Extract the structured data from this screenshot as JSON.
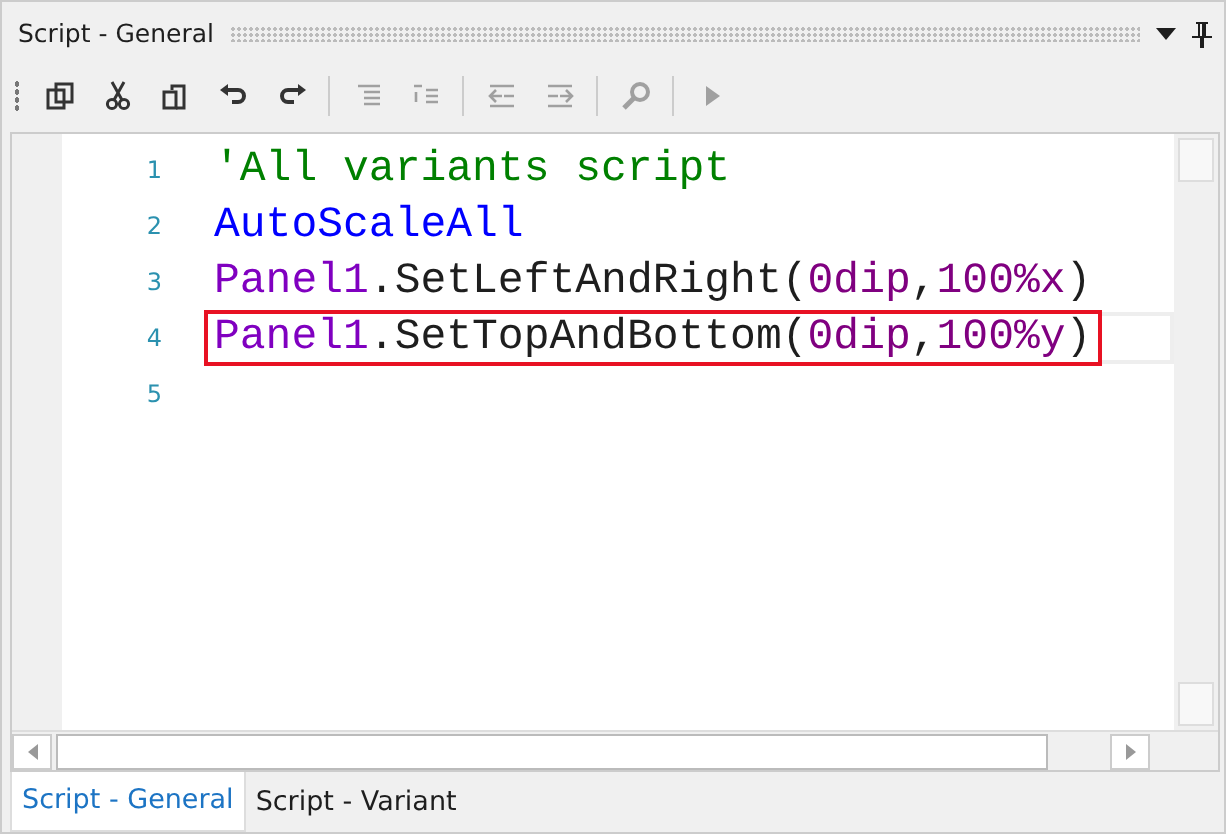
{
  "panel": {
    "title": "Script - General"
  },
  "toolbar": [
    {
      "kind": "copy",
      "disabled": false
    },
    {
      "kind": "cut",
      "disabled": false
    },
    {
      "kind": "paste",
      "disabled": false
    },
    {
      "kind": "undo",
      "disabled": false
    },
    {
      "kind": "redo",
      "disabled": false
    },
    {
      "kind": "sep"
    },
    {
      "kind": "comment",
      "disabled": true
    },
    {
      "kind": "uncomment",
      "disabled": true
    },
    {
      "kind": "sep"
    },
    {
      "kind": "outdent",
      "disabled": true
    },
    {
      "kind": "indent",
      "disabled": true
    },
    {
      "kind": "sep"
    },
    {
      "kind": "search",
      "disabled": true
    },
    {
      "kind": "sep"
    },
    {
      "kind": "run",
      "disabled": true
    }
  ],
  "editor": {
    "lines": [
      {
        "number": "1",
        "tokens": [
          {
            "kind": "comment",
            "text": "'All variants script"
          }
        ]
      },
      {
        "number": "2",
        "tokens": [
          {
            "kind": "keyword",
            "text": "AutoScaleAll"
          }
        ]
      },
      {
        "number": "3",
        "tokens": [
          {
            "kind": "object",
            "text": "Panel1"
          },
          {
            "kind": "plain",
            "text": ".SetLeftAndRight("
          },
          {
            "kind": "number",
            "text": "0dip"
          },
          {
            "kind": "plain",
            "text": ","
          },
          {
            "kind": "number",
            "text": "100%x"
          },
          {
            "kind": "plain",
            "text": ")"
          }
        ]
      },
      {
        "number": "4",
        "highlighted": true,
        "tokens": [
          {
            "kind": "object",
            "text": "Panel1"
          },
          {
            "kind": "plain",
            "text": ".SetTopAndBottom("
          },
          {
            "kind": "number",
            "text": "0dip"
          },
          {
            "kind": "plain",
            "text": ","
          },
          {
            "kind": "number",
            "text": "100%y"
          },
          {
            "kind": "plain",
            "text": ")"
          }
        ]
      },
      {
        "number": "5"
      }
    ]
  },
  "tabs": [
    {
      "label": "Script - General",
      "selected": true
    },
    {
      "label": "Script - Variant",
      "selected": false
    }
  ]
}
